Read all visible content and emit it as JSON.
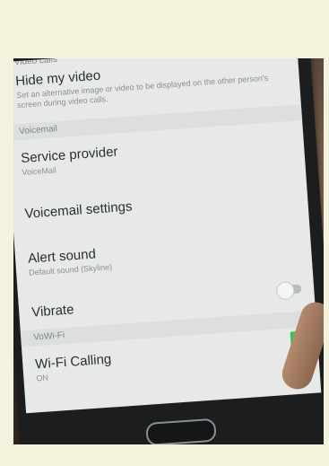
{
  "settings": {
    "video_calls_section": "Video calls",
    "hide_video": {
      "title": "Hide my video",
      "subtitle": "Set an alternative image or video to be displayed on the other person's screen during video calls."
    },
    "voicemail_section": "Voicemail",
    "service_provider": {
      "title": "Service provider",
      "subtitle": "VoiceMail"
    },
    "voicemail_settings": {
      "title": "Voicemail settings"
    },
    "alert_sound": {
      "title": "Alert sound",
      "subtitle": "Default sound (Skyline)"
    },
    "vibrate": {
      "title": "Vibrate",
      "enabled": false
    },
    "vowifi_section": "VoWi-Fi",
    "wifi_calling": {
      "title": "Wi-Fi Calling",
      "subtitle": "ON",
      "checked": true
    }
  },
  "icons": {
    "checkbox": "check-icon"
  },
  "colors": {
    "accent_green": "#3cc05a",
    "screen_bg": "#e7e9e8",
    "page_bg": "#f3f3dd"
  }
}
